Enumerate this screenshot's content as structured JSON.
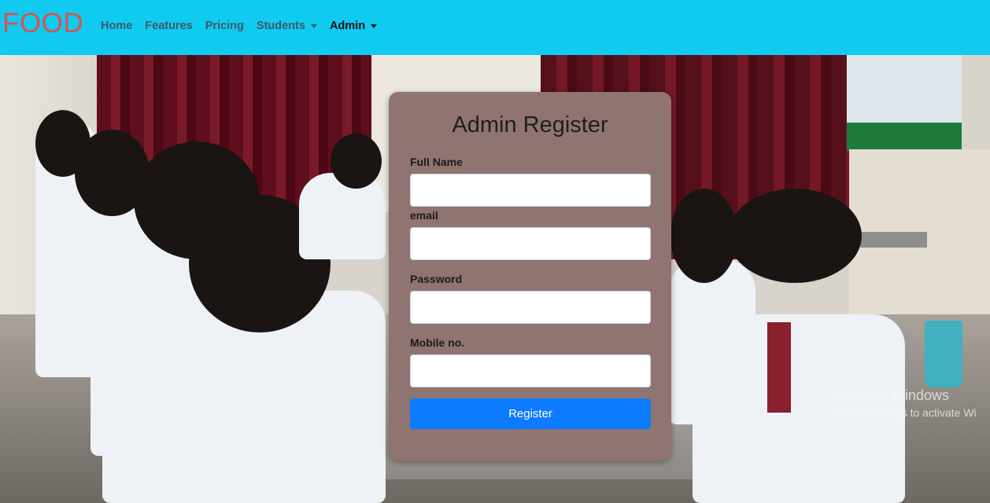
{
  "brand": "FOOD",
  "nav": {
    "home": "Home",
    "features": "Features",
    "pricing": "Pricing",
    "students": "Students",
    "admin": "Admin"
  },
  "form": {
    "title": "Admin Register",
    "full_name_label": "Full Name",
    "full_name_value": "",
    "email_label": "email",
    "email_value": "",
    "password_label": "Password",
    "password_value": "",
    "mobile_label": "Mobile no.",
    "mobile_value": "",
    "submit_label": "Register"
  },
  "watermark": {
    "title": "Activate Windows",
    "subtitle": "Go to Settings to activate Wi"
  },
  "colors": {
    "navbar": "#11caf0",
    "brand": "#d6544f",
    "card": "#8f7471",
    "button": "#0d7bff"
  }
}
